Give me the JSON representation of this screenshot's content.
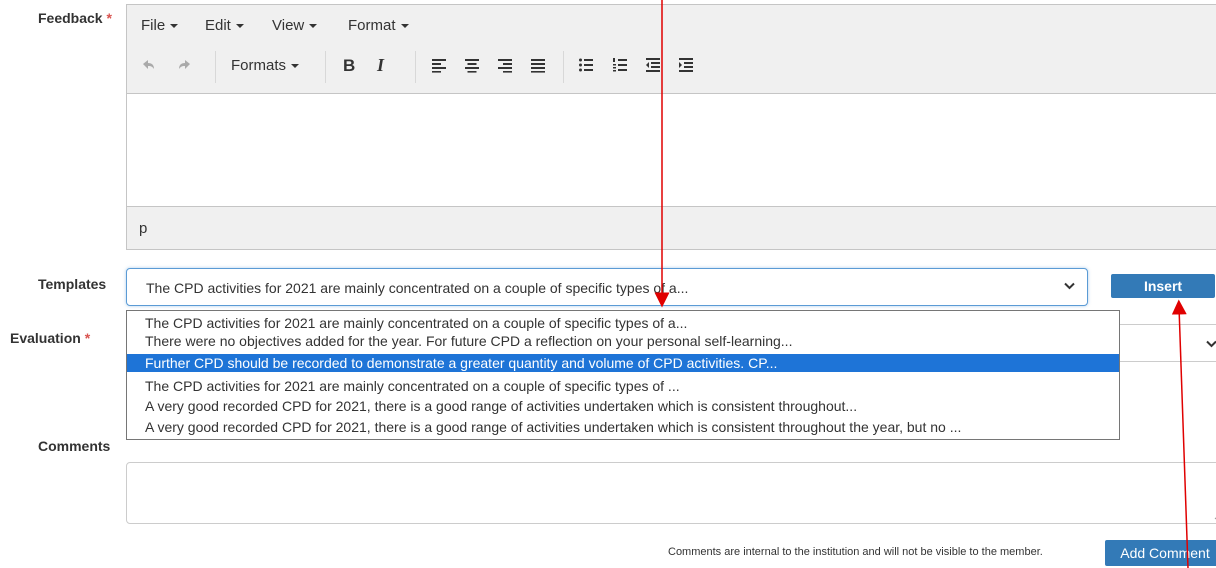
{
  "labels": {
    "feedback": "Feedback",
    "templates": "Templates",
    "evaluation": "Evaluation",
    "comments": "Comments",
    "required_mark": "*"
  },
  "editor": {
    "menu": [
      "File",
      "Edit",
      "View",
      "Format"
    ],
    "formats_label": "Formats",
    "bold_label": "B",
    "italic_label": "I",
    "status_path": "p"
  },
  "templates": {
    "selected": "The CPD activities for 2021 are mainly concentrated on a couple of specific types of a...",
    "options": [
      "The CPD activities for 2021 are mainly concentrated on a couple of specific types of a...",
      "There were no objectives added for the year. For future CPD a reflection on your personal self-learning...",
      "Further CPD should be recorded to demonstrate a greater quantity and volume of CPD activities. CP...",
      "The CPD activities for 2021 are mainly concentrated on a couple of specific types of ...",
      "A very good recorded CPD for 2021, there is a good range of activities undertaken which is consistent throughout...",
      "A very good recorded CPD for 2021, there is a good range of activities undertaken which is consistent throughout the year, but no ..."
    ],
    "highlighted_index": 2,
    "insert_label": "Insert"
  },
  "comments": {
    "note": "Comments are internal to the institution and will not be visible to the member.",
    "add_label": "Add Comment"
  },
  "colors": {
    "accent": "#337ab7",
    "highlight": "#1e74d7",
    "required": "#d9534f",
    "annotation": "#e00000"
  }
}
